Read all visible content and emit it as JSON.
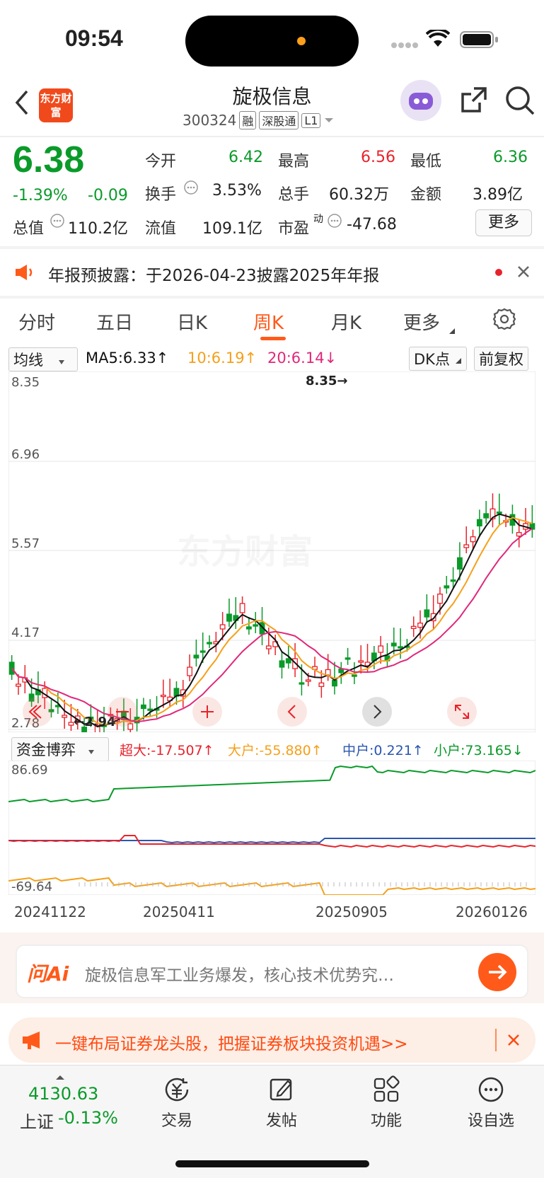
{
  "status_bar": {
    "time": "09:54"
  },
  "header": {
    "logo_text": "东方财富",
    "title": "旋极信息",
    "code": "300324",
    "tags": [
      "融",
      "深股通",
      "L1"
    ]
  },
  "quote": {
    "price": "6.38",
    "change_pct": "-1.39%",
    "change": "-0.09",
    "fields": [
      {
        "label": "今开",
        "value": "6.42",
        "color": "#0a9a2a"
      },
      {
        "label": "最高",
        "value": "6.56",
        "color": "#e8232b"
      },
      {
        "label": "最低",
        "value": "6.36",
        "color": "#0a9a2a"
      },
      {
        "label": "换手",
        "value": "3.53%",
        "color": "#222"
      },
      {
        "label": "总手",
        "value": "60.32万",
        "color": "#222"
      },
      {
        "label": "金额",
        "value": "3.89亿",
        "color": "#222"
      },
      {
        "label": "总值",
        "value": "110.2亿",
        "color": "#222"
      },
      {
        "label": "流值",
        "value": "109.1亿",
        "color": "#222"
      },
      {
        "label": "市盈",
        "value": "-47.68",
        "color": "#222"
      }
    ],
    "pe_superscript": "动",
    "more_button": "更多"
  },
  "notice": {
    "text": "年报预披露：于2026-04-23披露2025年年报"
  },
  "tabs": [
    "分时",
    "五日",
    "日K",
    "周K",
    "月K",
    "更多"
  ],
  "active_tab": "周K",
  "ma_row": {
    "selector": "均线",
    "ma5": "MA5:6.33↑",
    "ma10": "10:6.19↑",
    "ma20": "20:6.14↓",
    "dk_button": "DK点",
    "adjust_button": "前复权"
  },
  "kchart": {
    "y_labels": [
      "8.35",
      "6.96",
      "5.57",
      "4.17",
      "2.78"
    ],
    "high_marker": "8.35→",
    "low_marker": "←2.94",
    "watermark": "东方财富"
  },
  "fund_row": {
    "selector": "资金博弈",
    "super": "超大:-17.507↑",
    "big": "大户:-55.880↑",
    "mid": "中户:0.221↑",
    "small": "小户:73.165↓"
  },
  "fund_chart": {
    "y_max": "86.69",
    "y_min": "-69.64",
    "x_labels": [
      "20241122",
      "20250411",
      "20250905",
      "20260126"
    ]
  },
  "ai": {
    "logo": "问Ai",
    "text": "旋极信息军工业务爆发，核心技术优势究…"
  },
  "promo": {
    "text": "一键布局证券龙头股，把握证券板块投资机遇>>"
  },
  "bottom": {
    "index_value": "4130.63",
    "index_name": "上证",
    "index_change": "-0.13%",
    "items": [
      "交易",
      "发帖",
      "功能",
      "设自选"
    ]
  },
  "colors": {
    "up": "#e8232b",
    "down": "#0a9a2a",
    "accent": "#ff5a1a",
    "ma5": "#111111",
    "ma10": "#f5a01a",
    "ma20": "#e0287a"
  }
}
